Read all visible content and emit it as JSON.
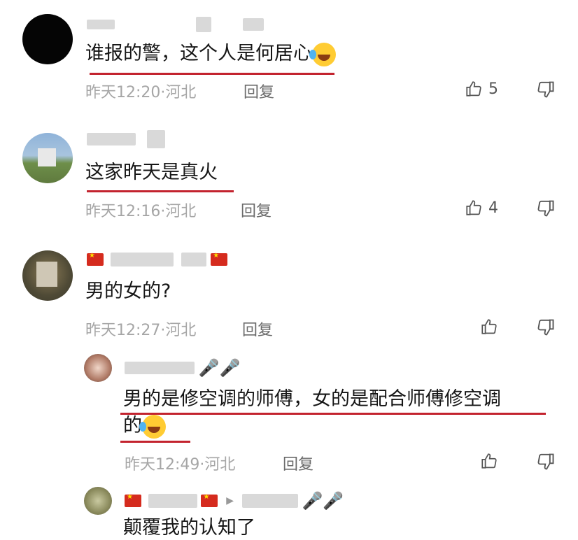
{
  "comments": [
    {
      "text": "谁报的警，这个人是何居心",
      "time": "昨天12:20",
      "sep": "·",
      "location": "河北",
      "reply": "回复",
      "likes": "5"
    },
    {
      "text": "这家昨天是真火",
      "time": "昨天12:16",
      "sep": "·",
      "location": "河北",
      "reply": "回复",
      "likes": "4"
    },
    {
      "text": "男的女的?",
      "time": "昨天12:27",
      "sep": "·",
      "location": "河北",
      "reply": "回复",
      "likes": ""
    }
  ],
  "replies": [
    {
      "text_line1": "男的是修空调的师傅，女的是配合师傅修空调",
      "text_line2": "的",
      "time": "昨天12:49",
      "sep": "·",
      "location": "河北",
      "reply": "回复"
    },
    {
      "text": "颠覆我的认知了"
    }
  ],
  "icons": {
    "like": "thumb-up-icon",
    "dislike": "thumb-down-icon",
    "emoji": "laughing-tears-emoji",
    "mic": "microphone-icon",
    "flag": "china-flag-icon"
  },
  "colors": {
    "underline": "#c3232e",
    "meta": "#a6a6a6"
  }
}
